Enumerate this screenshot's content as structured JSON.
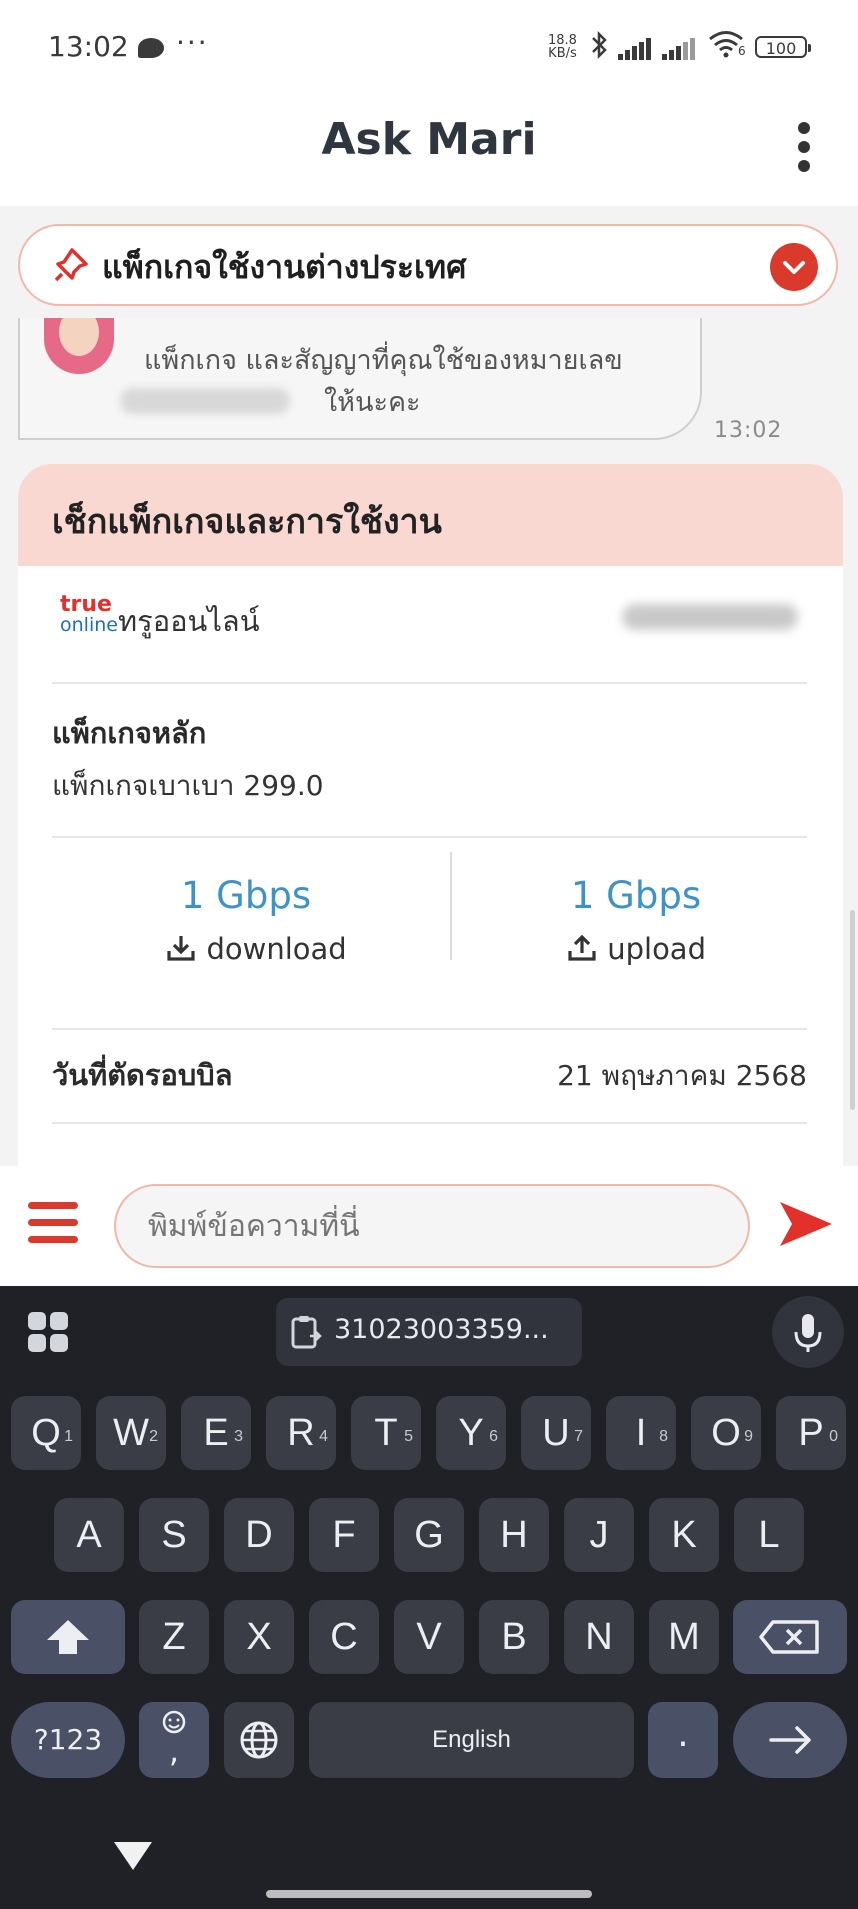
{
  "status_bar": {
    "time": "13:02",
    "more": "···",
    "net_speed_value": "18.8",
    "net_speed_unit": "KB/s",
    "wifi_badge": "6",
    "battery": "100"
  },
  "header": {
    "title": "Ask Mari"
  },
  "pinned": {
    "label": "แพ็กเกจใช้งานต่างประเทศ"
  },
  "chat": {
    "message_lines": [
      "แพ็กเกจ และสัญญาที่คุณใช้ของหมายเลข",
      "ให้นะคะ"
    ],
    "message_time": "13:02"
  },
  "card": {
    "title": "เช็กแพ็กเกจและการใช้งาน",
    "logo_text_1": "true",
    "logo_text_2": "online",
    "operator": "ทรูออนไลน์",
    "main_package_label": "แพ็กเกจหลัก",
    "main_package_name": "แพ็กเกจเบาเบา 299.0",
    "download_speed": "1 Gbps",
    "download_label": "download",
    "upload_speed": "1 Gbps",
    "upload_label": "upload",
    "billing_label": "วันที่ตัดรอบบิล",
    "billing_date": "21 พฤษภาคม 2568"
  },
  "input": {
    "placeholder": "พิมพ์ข้อความที่นี่"
  },
  "keyboard": {
    "clipboard": "31023003359...",
    "row1": [
      {
        "k": "Q",
        "h": "1"
      },
      {
        "k": "W",
        "h": "2"
      },
      {
        "k": "E",
        "h": "3"
      },
      {
        "k": "R",
        "h": "4"
      },
      {
        "k": "T",
        "h": "5"
      },
      {
        "k": "Y",
        "h": "6"
      },
      {
        "k": "U",
        "h": "7"
      },
      {
        "k": "I",
        "h": "8"
      },
      {
        "k": "O",
        "h": "9"
      },
      {
        "k": "P",
        "h": "0"
      }
    ],
    "row2": [
      "A",
      "S",
      "D",
      "F",
      "G",
      "H",
      "J",
      "K",
      "L"
    ],
    "row3": [
      "Z",
      "X",
      "C",
      "V",
      "B",
      "N",
      "M"
    ],
    "symbols_key": "?123",
    "emoji_comma": ",",
    "space_label": "English",
    "period": "."
  },
  "colors": {
    "accent_red": "#d93a2b",
    "speed_blue": "#3d93c9",
    "card_header_pink": "#f9d8d2",
    "keyboard_bg": "#1f2127"
  },
  "icons": [
    "chat-bubble-icon",
    "bluetooth-icon",
    "signal-icon",
    "wifi-icon",
    "battery-icon",
    "more-vertical-icon",
    "pin-icon",
    "chevron-down-icon",
    "download-icon",
    "upload-icon",
    "hamburger-menu-icon",
    "send-icon",
    "apps-grid-icon",
    "clipboard-icon",
    "microphone-icon",
    "shift-icon",
    "backspace-icon",
    "emoji-icon",
    "globe-icon",
    "enter-arrow-icon",
    "nav-back-icon"
  ]
}
